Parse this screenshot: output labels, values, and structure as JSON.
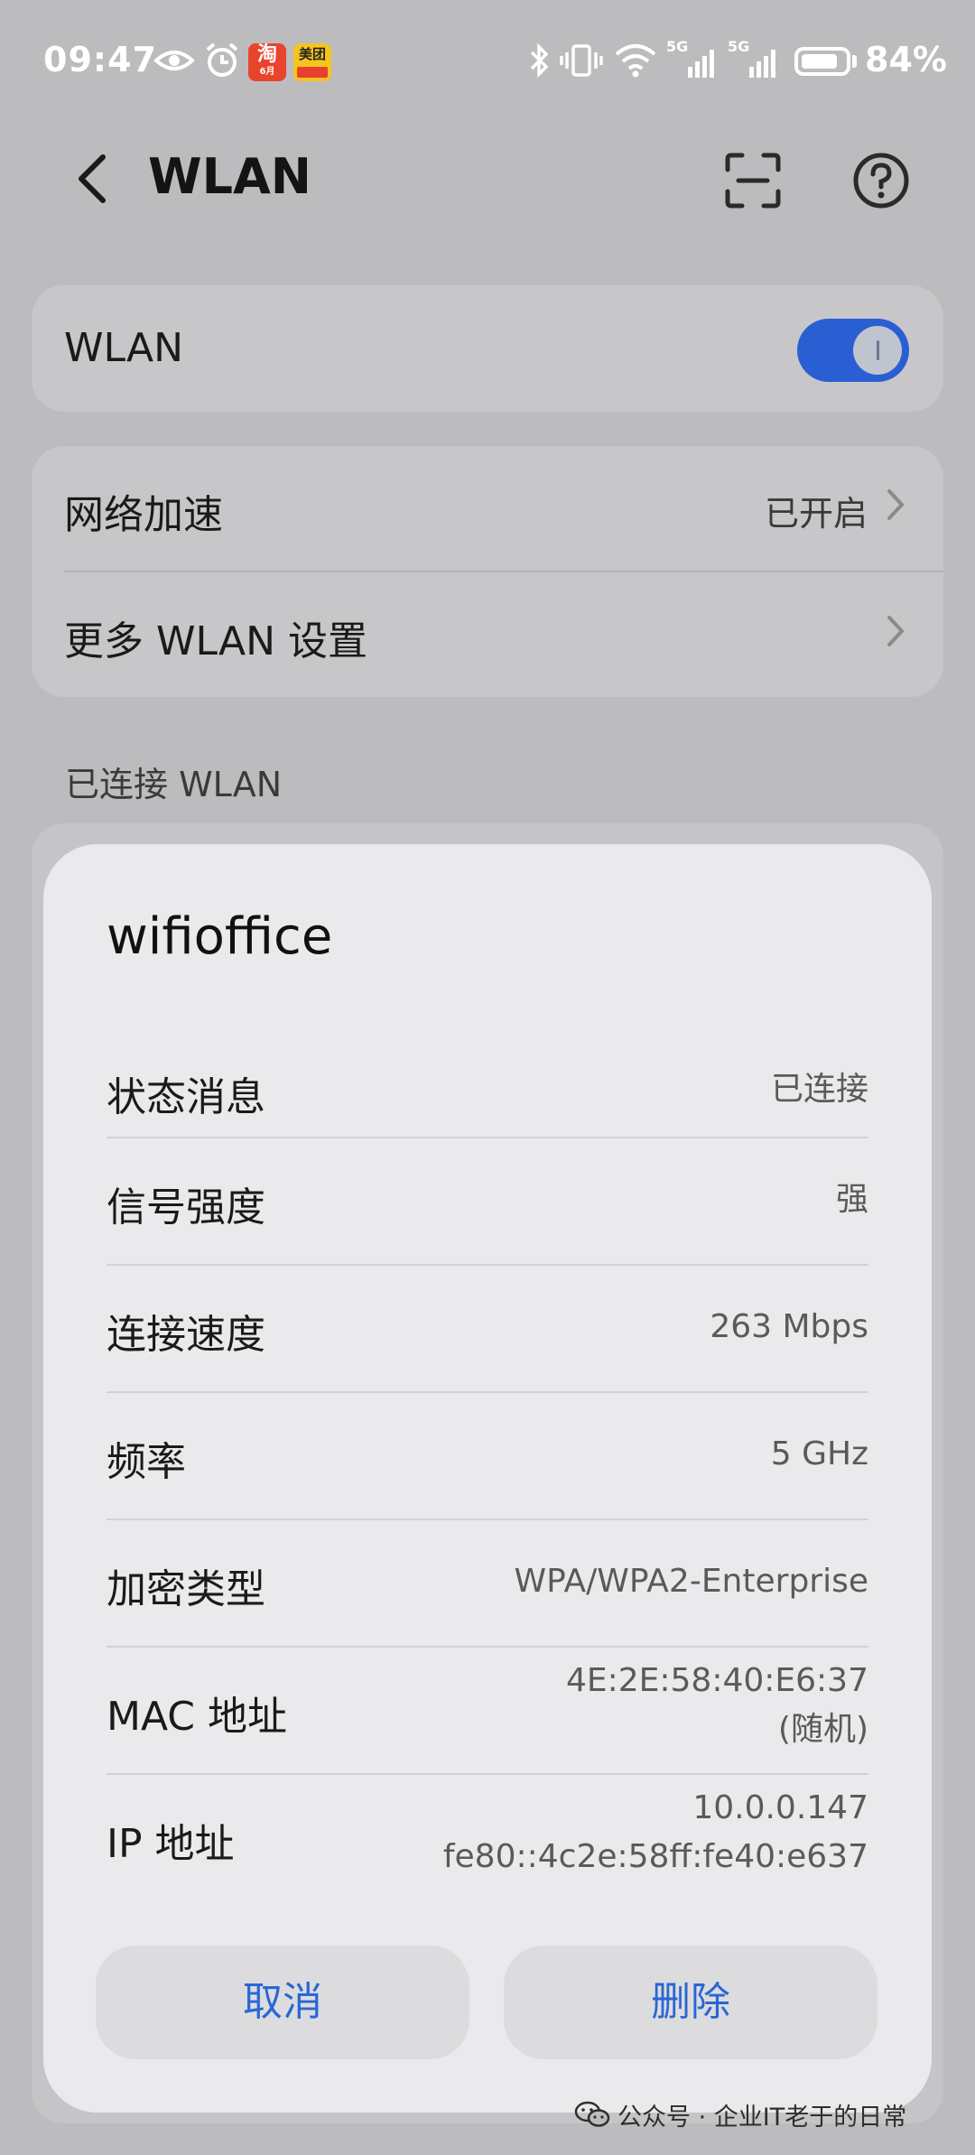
{
  "status_bar": {
    "time": "09:47",
    "taobao_badge": "淘",
    "taobao_sub": "6月",
    "meituan_badge": "美团",
    "network_1": "5G",
    "network_2": "5G",
    "battery_percent": "84%",
    "battery_level": 0.84
  },
  "header": {
    "title": "WLAN"
  },
  "wlan_card": {
    "label": "WLAN",
    "toggle_on": true
  },
  "settings": {
    "acceleration": {
      "label": "网络加速",
      "value": "已开启"
    },
    "more": {
      "label": "更多 WLAN 设置"
    }
  },
  "section_connected": "已连接 WLAN",
  "dialog": {
    "title": "wifioffice",
    "rows": [
      {
        "label": "状态消息",
        "value": "已连接"
      },
      {
        "label": "信号强度",
        "value": "强"
      },
      {
        "label": "连接速度",
        "value": "263 Mbps"
      },
      {
        "label": "频率",
        "value": "5 GHz"
      },
      {
        "label": "加密类型",
        "value": "WPA/WPA2-Enterprise"
      },
      {
        "label": "MAC 地址",
        "value": "4E:2E:58:40:E6:37",
        "value2": "(随机)"
      },
      {
        "label": "IP 地址",
        "value": "10.0.0.147",
        "value2": "fe80::4c2e:58ff:fe40:e637"
      }
    ],
    "cancel": "取消",
    "delete": "删除"
  },
  "watermark": "公众号 · 企业IT老于的日常",
  "colors": {
    "accent": "#2a66d6",
    "toggle": "#2a5fd3",
    "background": "#bcbcbe"
  }
}
